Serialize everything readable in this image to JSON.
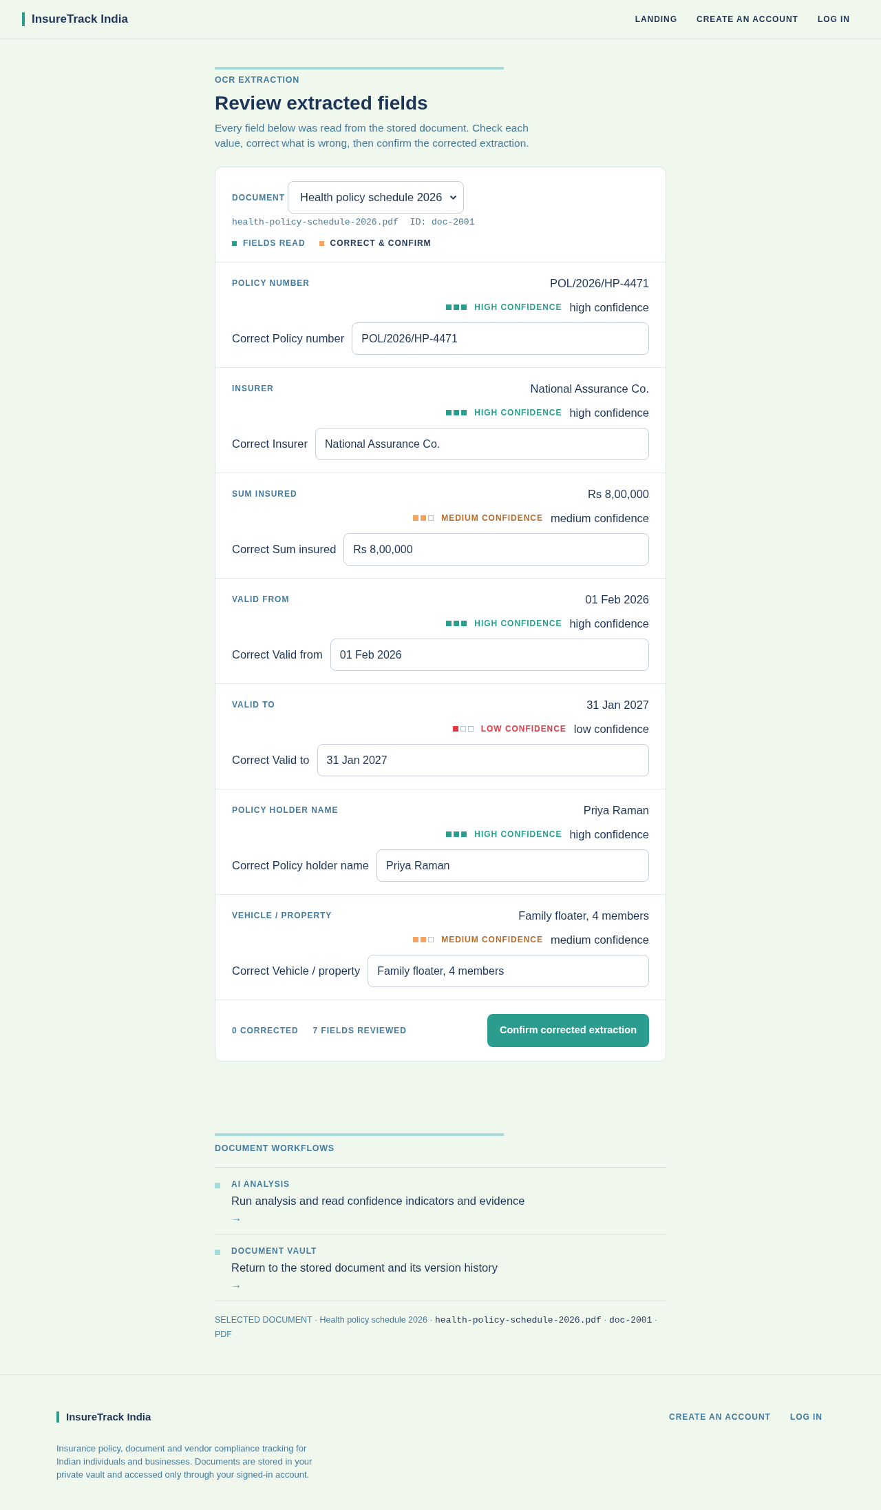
{
  "header": {
    "brand": "InsureTrack India",
    "nav": [
      {
        "label": "LANDING"
      },
      {
        "label": "CREATE AN ACCOUNT"
      },
      {
        "label": "LOG IN"
      }
    ]
  },
  "intro": {
    "eyebrow": "OCR EXTRACTION",
    "title": "Review extracted fields",
    "description": "Every field below was read from the stored document. Check each value, correct what is wrong, then confirm the corrected extraction."
  },
  "document": {
    "label": "DOCUMENT",
    "selected_option": "Health policy schedule 2026",
    "filename": "health-policy-schedule-2026.pdf",
    "id": "ID: doc-2001",
    "steps": [
      {
        "label": "FIELDS READ",
        "color": "#2a9d8f",
        "current": false
      },
      {
        "label": "CORRECT & CONFIRM",
        "color": "#f4a261",
        "current": true
      }
    ]
  },
  "fields": [
    {
      "label": "POLICY NUMBER",
      "value": "POL/2026/HP-4471",
      "kind": "high",
      "confidence_label": "HIGH CONFIDENCE",
      "confidence_note": "high confidence",
      "input_label": "Correct Policy number",
      "input_value": "POL/2026/HP-4471"
    },
    {
      "label": "INSURER",
      "value": "National Assurance Co.",
      "kind": "high",
      "confidence_label": "HIGH CONFIDENCE",
      "confidence_note": "high confidence",
      "input_label": "Correct Insurer",
      "input_value": "National Assurance Co."
    },
    {
      "label": "SUM INSURED",
      "value": "Rs 8,00,000",
      "kind": "medium",
      "confidence_label": "MEDIUM CONFIDENCE",
      "confidence_note": "medium confidence",
      "input_label": "Correct Sum insured",
      "input_value": "Rs 8,00,000"
    },
    {
      "label": "VALID FROM",
      "value": "01 Feb 2026",
      "kind": "high",
      "confidence_label": "HIGH CONFIDENCE",
      "confidence_note": "high confidence",
      "input_label": "Correct Valid from",
      "input_value": "01 Feb 2026"
    },
    {
      "label": "VALID TO",
      "value": "31 Jan 2027",
      "kind": "low",
      "confidence_label": "LOW CONFIDENCE",
      "confidence_note": "low confidence",
      "input_label": "Correct Valid to",
      "input_value": "31 Jan 2027"
    },
    {
      "label": "POLICY HOLDER NAME",
      "value": "Priya Raman",
      "kind": "high",
      "confidence_label": "HIGH CONFIDENCE",
      "confidence_note": "high confidence",
      "input_label": "Correct Policy holder name",
      "input_value": "Priya Raman"
    },
    {
      "label": "VEHICLE / PROPERTY",
      "value": "Family floater, 4 members",
      "kind": "medium",
      "confidence_label": "MEDIUM CONFIDENCE",
      "confidence_note": "medium confidence",
      "input_label": "Correct Vehicle / property",
      "input_value": "Family floater, 4 members"
    }
  ],
  "summary": {
    "stats": [
      "**0** CORRECTED",
      "**7** FIELDS REVIEWED"
    ],
    "button": "Confirm corrected extraction"
  },
  "workflows": {
    "title": "DOCUMENT WORKFLOWS",
    "items": [
      {
        "label": "AI ANALYSIS",
        "description": "Run analysis and read confidence indicators and evidence",
        "arrow": "→"
      },
      {
        "label": "DOCUMENT VAULT",
        "description": "Return to the stored document and its version history",
        "arrow": "→"
      }
    ],
    "selected_document": [
      {
        "kind": "text",
        "text": "SELECTED DOCUMENT · Health policy schedule 2026 · "
      },
      {
        "kind": "code",
        "text": "health-policy-schedule-2026.pdf"
      },
      {
        "kind": "text",
        "text": " · "
      },
      {
        "kind": "code",
        "text": "doc-2001"
      },
      {
        "kind": "text",
        "text": " · PDF"
      }
    ]
  },
  "footer": {
    "brand": "InsureTrack India",
    "links": [
      {
        "label": "CREATE AN ACCOUNT"
      },
      {
        "label": "LOG IN"
      }
    ],
    "description": "Insurance policy, document and vendor compliance tracking for Indian individuals and businesses. Documents are stored in your private vault and accessed only through your signed-in account."
  }
}
